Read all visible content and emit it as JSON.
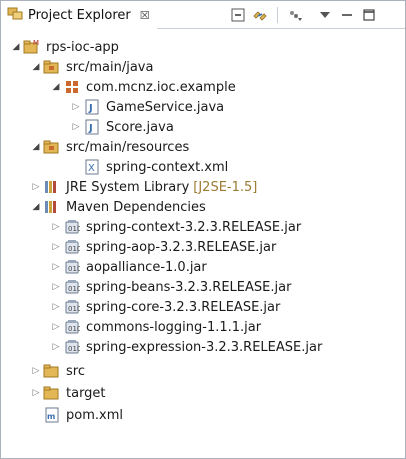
{
  "view": {
    "tab_title": "Project Explorer",
    "close_glyph": "☒"
  },
  "toolbar": {
    "icons": [
      "collapse-all-icon",
      "link-with-editor-icon",
      "view-menu-icon",
      "minimize-icon",
      "maximize-icon"
    ]
  },
  "tree": {
    "project": {
      "label": "rps-ioc-app",
      "expanded": true
    },
    "src_main_java": {
      "label": "src/main/java",
      "expanded": true
    },
    "package": {
      "label": "com.mcnz.ioc.example",
      "expanded": true
    },
    "gameservice": {
      "label": "GameService.java"
    },
    "score": {
      "label": "Score.java"
    },
    "src_main_resources": {
      "label": "src/main/resources",
      "expanded": true
    },
    "spring_context_xml": {
      "label": "spring-context.xml"
    },
    "jre": {
      "label": "JRE System Library",
      "decoration": "[J2SE-1.5]"
    },
    "maven": {
      "label": "Maven Dependencies",
      "expanded": true
    },
    "jars": [
      "spring-context-3.2.3.RELEASE.jar",
      "spring-aop-3.2.3.RELEASE.jar",
      "aopalliance-1.0.jar",
      "spring-beans-3.2.3.RELEASE.jar",
      "spring-core-3.2.3.RELEASE.jar",
      "commons-logging-1.1.1.jar",
      "spring-expression-3.2.3.RELEASE.jar"
    ],
    "src": {
      "label": "src"
    },
    "target": {
      "label": "target"
    },
    "pom": {
      "label": "pom.xml"
    }
  },
  "colors": {
    "folder": "#e3b755",
    "package": "#b5542a",
    "java": "#3a6fb0",
    "jar": "#8a9bb3"
  }
}
